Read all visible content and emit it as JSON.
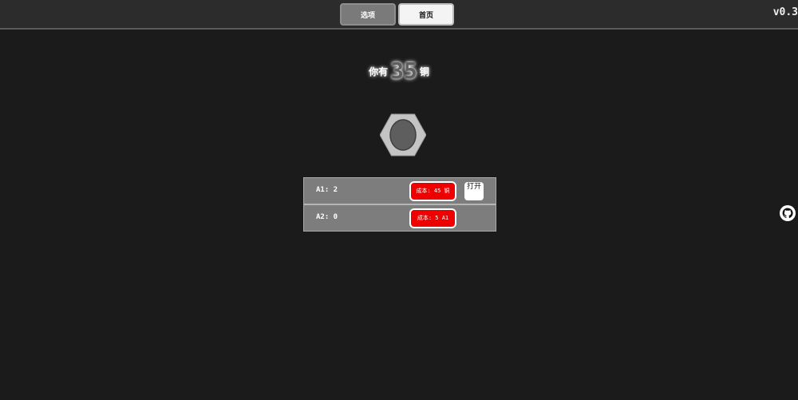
{
  "header": {
    "tabs": {
      "options": "选项",
      "home": "首页"
    },
    "version": "v0.3"
  },
  "currency": {
    "prefix": "你有",
    "amount": "35",
    "unit": "铜"
  },
  "nut_icon": "hex-nut-icon",
  "upgrades": [
    {
      "label": "A1: 2",
      "cost": "成本: 45 铜",
      "open_label": "打开"
    },
    {
      "label": "A2: 0",
      "cost": "成本: 5 A1"
    }
  ],
  "colors": {
    "background": "#1b1b1b",
    "cost_button": "#ee0000",
    "row": "#7d7d7d"
  },
  "side_icon": "github-icon"
}
